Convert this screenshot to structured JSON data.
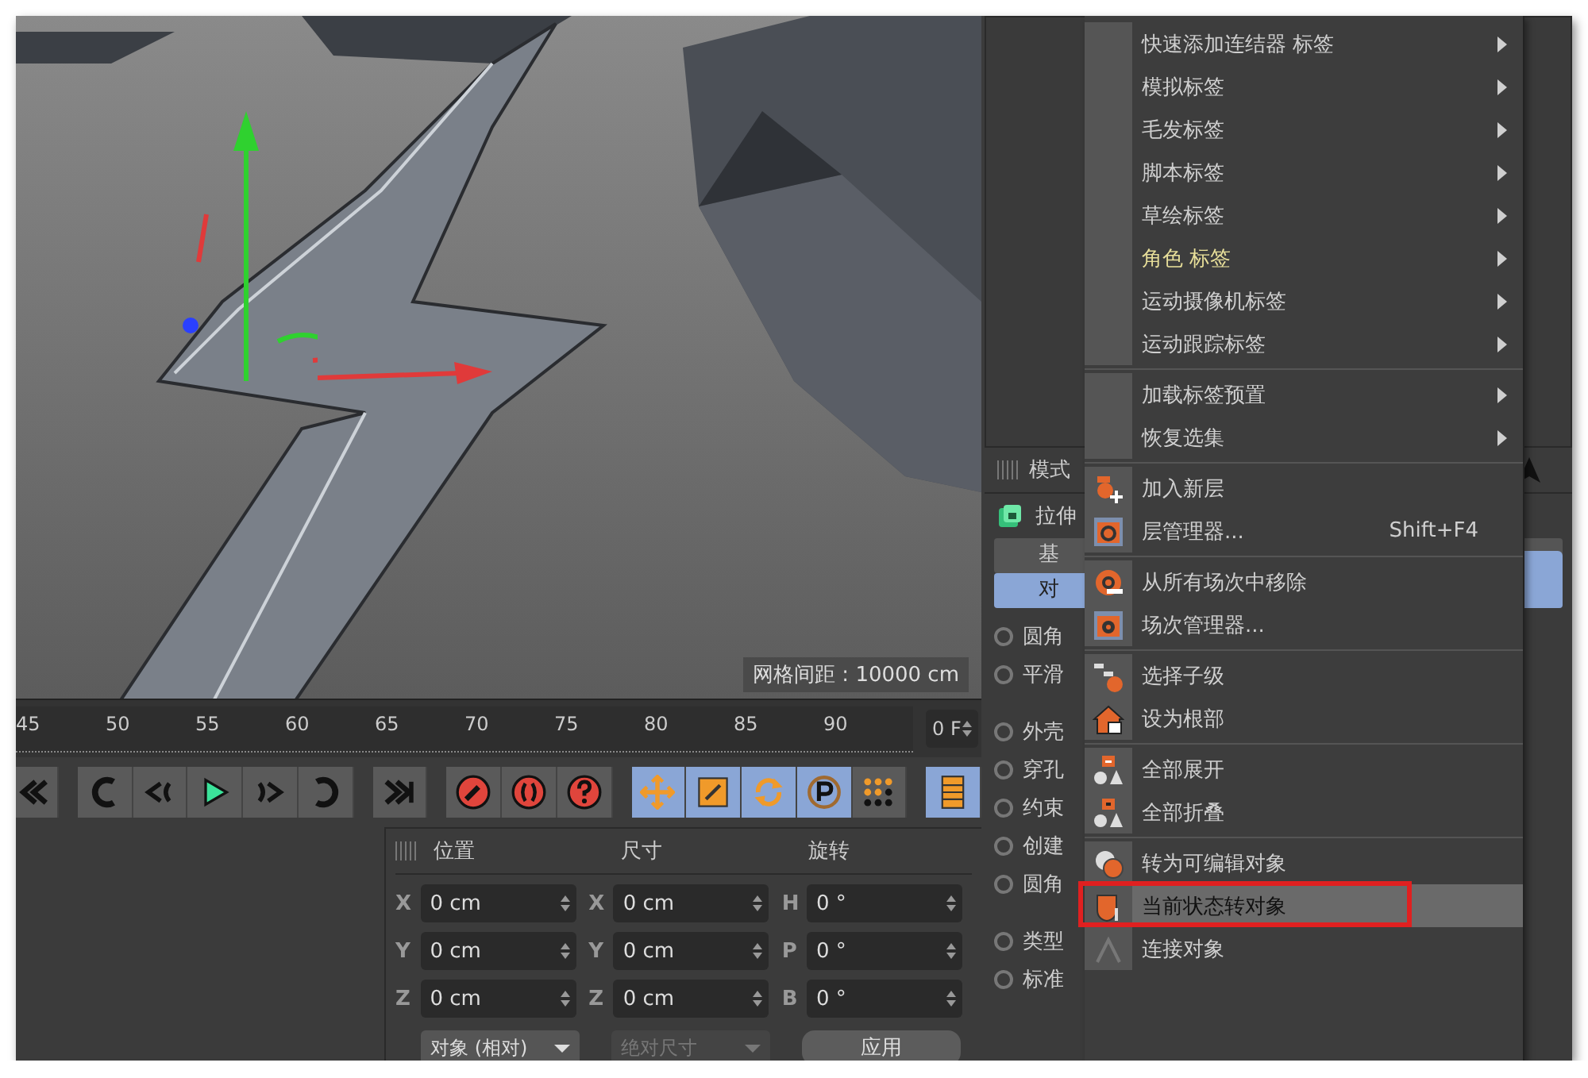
{
  "viewport": {
    "grid_label": "网格间距 : 10000 cm"
  },
  "timeline": {
    "ticks": [
      "45",
      "50",
      "55",
      "60",
      "65",
      "70",
      "75",
      "80",
      "85",
      "90"
    ],
    "frame_field": "0 F"
  },
  "transport": [
    {
      "kind": "to-start",
      "active": false
    },
    {
      "kind": "prev-key",
      "active": false
    },
    {
      "kind": "step-back",
      "active": false
    },
    {
      "kind": "play",
      "active": false
    },
    {
      "kind": "step-forward",
      "active": false
    },
    {
      "kind": "next-key",
      "active": false
    },
    {
      "kind": "to-end",
      "active": false
    },
    {
      "kind": "record",
      "active": false
    },
    {
      "kind": "auto-key",
      "active": false
    },
    {
      "kind": "help",
      "active": false
    },
    {
      "kind": "move",
      "active": true
    },
    {
      "kind": "scale",
      "active": true
    },
    {
      "kind": "rotate",
      "active": true
    },
    {
      "kind": "param",
      "active": true
    },
    {
      "kind": "points",
      "active": false
    },
    {
      "kind": "film",
      "active": true
    }
  ],
  "coordinates": {
    "headers": [
      "位置",
      "尺寸",
      "旋转"
    ],
    "rows": [
      [
        {
          "axis": "X",
          "value": "0 cm"
        },
        {
          "axis": "X",
          "value": "0 cm"
        },
        {
          "axis": "H",
          "value": "0 °"
        }
      ],
      [
        {
          "axis": "Y",
          "value": "0 cm"
        },
        {
          "axis": "Y",
          "value": "0 cm"
        },
        {
          "axis": "P",
          "value": "0 °"
        }
      ],
      [
        {
          "axis": "Z",
          "value": "0 cm"
        },
        {
          "axis": "Z",
          "value": "0 cm"
        },
        {
          "axis": "B",
          "value": "0 °"
        }
      ]
    ],
    "mode_dropdown": {
      "label": "对象 (相对)",
      "disabled": false
    },
    "size_dropdown": {
      "label": "绝对尺寸",
      "disabled": true
    },
    "apply_button": "应用"
  },
  "attributes": {
    "mode_label": "模式",
    "object_name": "拉伸",
    "tabs": [
      {
        "label": "基",
        "selected": false
      },
      {
        "label": "对",
        "selected": true
      }
    ],
    "options": [
      {
        "label": "圆角",
        "checked": false
      },
      {
        "label": "平滑",
        "checked": false
      },
      {
        "label": "外壳",
        "checked": false
      },
      {
        "label": "穿孔",
        "checked": false
      },
      {
        "label": "约束",
        "checked": false
      },
      {
        "label": "创建",
        "checked": false
      },
      {
        "label": "圆角",
        "checked": false
      },
      {
        "label": "类型",
        "checked": false
      },
      {
        "label": "标准",
        "checked": false
      }
    ]
  },
  "context_menu": {
    "groups": [
      [
        {
          "label": "快速添加连结器 标签",
          "kind": "none",
          "submenu": true,
          "highlighted": false,
          "selected": false
        },
        {
          "label": "模拟标签",
          "kind": "none",
          "submenu": true,
          "highlighted": false,
          "selected": false
        },
        {
          "label": "毛发标签",
          "kind": "none",
          "submenu": true,
          "highlighted": false,
          "selected": false
        },
        {
          "label": "脚本标签",
          "kind": "none",
          "submenu": true,
          "highlighted": false,
          "selected": false
        },
        {
          "label": "草绘标签",
          "kind": "none",
          "submenu": true,
          "highlighted": false,
          "selected": false
        },
        {
          "label": "角色 标签",
          "kind": "none",
          "submenu": true,
          "highlighted": true,
          "selected": false
        },
        {
          "label": "运动摄像机标签",
          "kind": "none",
          "submenu": true,
          "highlighted": false,
          "selected": false
        },
        {
          "label": "运动跟踪标签",
          "kind": "none",
          "submenu": true,
          "highlighted": false,
          "selected": false
        }
      ],
      [
        {
          "label": "加载标签预置",
          "kind": "none",
          "submenu": true,
          "highlighted": false,
          "selected": false
        },
        {
          "label": "恢复选集",
          "kind": "none",
          "submenu": true,
          "highlighted": false,
          "selected": false
        }
      ],
      [
        {
          "label": "加入新层",
          "kind": "layer-add",
          "submenu": false,
          "highlighted": false,
          "selected": false
        },
        {
          "label": "层管理器...",
          "kind": "layer-manager",
          "submenu": false,
          "shortcut": "Shift+F4",
          "highlighted": false,
          "selected": false
        }
      ],
      [
        {
          "label": "从所有场次中移除",
          "kind": "take-remove",
          "submenu": false,
          "highlighted": false,
          "selected": false
        },
        {
          "label": "场次管理器...",
          "kind": "take-manager",
          "submenu": false,
          "highlighted": false,
          "selected": false
        }
      ],
      [
        {
          "label": "选择子级",
          "kind": "select-children",
          "submenu": false,
          "highlighted": false,
          "selected": false
        },
        {
          "label": "设为根部",
          "kind": "set-root",
          "submenu": false,
          "highlighted": false,
          "selected": false
        }
      ],
      [
        {
          "label": "全部展开",
          "kind": "expand",
          "submenu": false,
          "highlighted": false,
          "selected": false
        },
        {
          "label": "全部折叠",
          "kind": "collapse",
          "submenu": false,
          "highlighted": false,
          "selected": false
        }
      ],
      [
        {
          "label": "转为可编辑对象",
          "kind": "make-editable",
          "submenu": false,
          "highlighted": false,
          "selected": false
        },
        {
          "label": "当前状态转对象",
          "kind": "current-state",
          "submenu": false,
          "highlighted": false,
          "selected": true
        },
        {
          "label": "连接对象",
          "kind": "connect",
          "submenu": false,
          "highlighted": false,
          "selected": false
        }
      ]
    ]
  }
}
